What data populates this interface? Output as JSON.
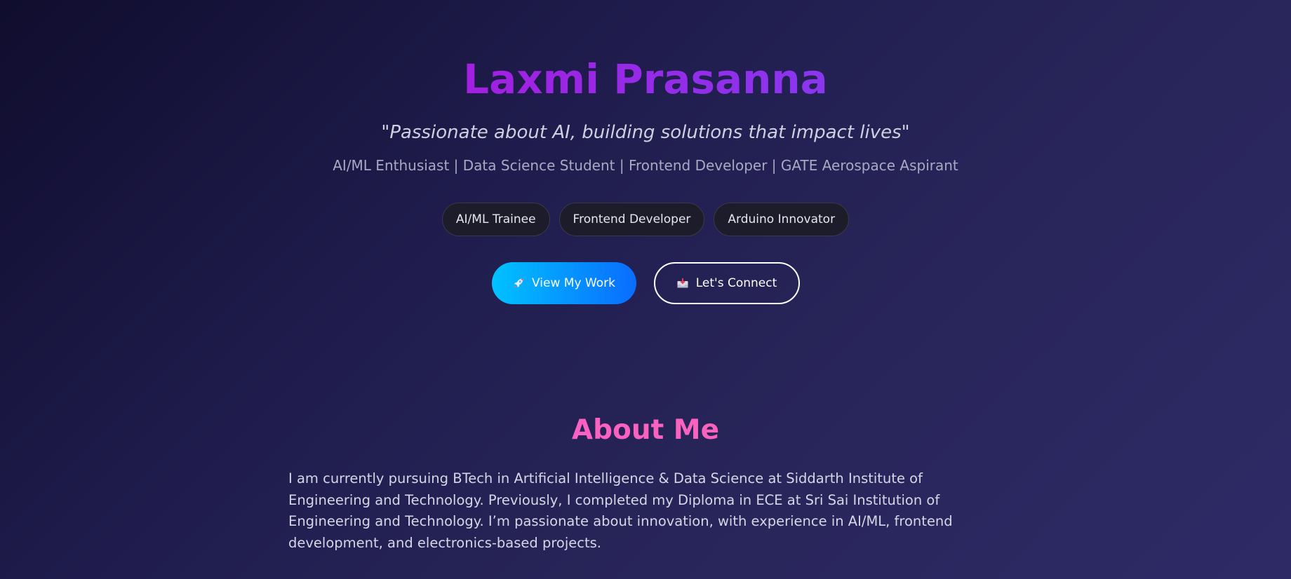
{
  "hero": {
    "name": "Laxmi Prasanna",
    "tagline": "\"Passionate about AI, building solutions that impact lives\"",
    "roles": "AI/ML Enthusiast | Data Science Student | Frontend Developer | GATE Aerospace Aspirant",
    "chips": [
      {
        "label": "AI/ML Trainee"
      },
      {
        "label": "Frontend Developer"
      },
      {
        "label": "Arduino Innovator"
      }
    ],
    "cta": {
      "primary_label": "View My Work",
      "primary_icon": "rocket-icon",
      "secondary_label": "Let's Connect",
      "secondary_icon": "inbox-tray-icon"
    }
  },
  "about": {
    "title": "About Me",
    "text": "I am currently pursuing BTech in Artificial Intelligence & Data Science at Siddarth Institute of Engineering and Technology. Previously, I completed my Diploma in ECE at Sri Sai Institution of Engineering and Technology. I’m passionate about innovation, with experience in AI/ML, frontend development, and electronics-based projects."
  },
  "colors": {
    "background_start": "#100d2e",
    "background_end": "#2e2a66",
    "name_gradient_start": "#a21fe0",
    "name_gradient_end": "#8a36ef",
    "primary_button_start": "#00c2ff",
    "primary_button_end": "#0a6cff",
    "about_title": "#ff5ec4"
  }
}
